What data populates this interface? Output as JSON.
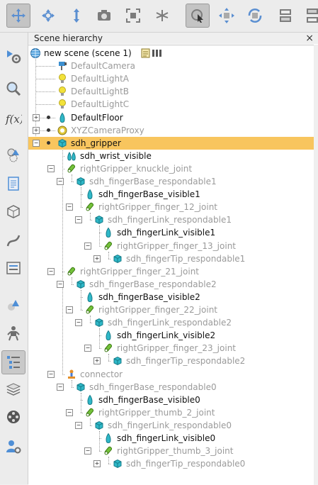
{
  "panel": {
    "title": "Scene hierarchy",
    "close": "×"
  },
  "toolbar": [
    {
      "icon": "move-view-icon",
      "active": true
    },
    {
      "icon": "rotate-view-icon",
      "active": false
    },
    {
      "icon": "shift-view-icon",
      "active": false
    },
    {
      "icon": "camera-icon",
      "active": false
    },
    {
      "icon": "fit-view-icon",
      "active": false
    },
    {
      "icon": "fly-icon",
      "active": false
    },
    {
      "icon": "select-icon",
      "active": true
    },
    {
      "icon": "object-move-icon",
      "active": false
    },
    {
      "icon": "object-rotate-icon",
      "active": false
    },
    {
      "icon": "assemble-icon",
      "active": false
    },
    {
      "icon": "disassemble-icon",
      "active": false
    }
  ],
  "sidebar": [
    {
      "icon": "simulation-settings-icon",
      "active": false
    },
    {
      "icon": "zoom-icon",
      "active": false
    },
    {
      "icon": "script-function-icon",
      "active": false
    },
    {
      "icon": "shape-edit-icon",
      "active": false
    },
    {
      "icon": "document-icon",
      "active": false
    },
    {
      "icon": "cube-icon",
      "active": false
    },
    {
      "icon": "path-icon",
      "active": false
    },
    {
      "icon": "panel-icon",
      "active": false
    },
    {
      "icon": "shapes-icon",
      "active": false
    },
    {
      "icon": "robot-icon",
      "active": false
    },
    {
      "icon": "hierarchy-list-icon",
      "active": true
    },
    {
      "icon": "layers-icon",
      "active": false
    },
    {
      "icon": "film-icon",
      "active": false
    },
    {
      "icon": "user-settings-icon",
      "active": false
    }
  ],
  "tree": [
    {
      "label": "new scene (scene 1)",
      "depth": 0,
      "icon": "globe",
      "style": "blk",
      "extra": true
    },
    {
      "label": "DefaultCamera",
      "depth": 1,
      "icon": "camera",
      "style": "gray"
    },
    {
      "label": "DefaultLightA",
      "depth": 1,
      "icon": "light",
      "style": "gray"
    },
    {
      "label": "DefaultLightB",
      "depth": 1,
      "icon": "light",
      "style": "gray"
    },
    {
      "label": "DefaultLightC",
      "depth": 1,
      "icon": "light",
      "style": "gray"
    },
    {
      "label": "DefaultFloor",
      "depth": 1,
      "icon": "shape-visible",
      "style": "blk",
      "expander": "+",
      "dot": true
    },
    {
      "label": "XYZCameraProxy",
      "depth": 1,
      "icon": "dummy",
      "style": "gray",
      "expander": "+",
      "dot": true
    },
    {
      "label": "sdh_gripper",
      "depth": 1,
      "icon": "shape-respondable",
      "style": "blk",
      "expander": "−",
      "dot": true,
      "selected": true
    },
    {
      "label": "sdh_wrist_visible",
      "depth": 2,
      "icon": "shape-visible-multi",
      "style": "blk"
    },
    {
      "label": "rightGripper_knuckle_joint",
      "depth": 2,
      "icon": "joint",
      "style": "gray",
      "expander": "−"
    },
    {
      "label": "sdh_fingerBase_respondable1",
      "depth": 3,
      "icon": "shape-respondable",
      "style": "gray",
      "expander": "−"
    },
    {
      "label": "sdh_fingerBase_visible1",
      "depth": 4,
      "icon": "shape-visible",
      "style": "blk"
    },
    {
      "label": "rightGripper_finger_12_joint",
      "depth": 4,
      "icon": "joint",
      "style": "gray",
      "expander": "−"
    },
    {
      "label": "sdh_fingerLink_respondable1",
      "depth": 5,
      "icon": "shape-respondable",
      "style": "gray",
      "expander": "−"
    },
    {
      "label": "sdh_fingerLink_visible1",
      "depth": 6,
      "icon": "shape-visible",
      "style": "blk"
    },
    {
      "label": "rightGripper_finger_13_joint",
      "depth": 6,
      "icon": "joint",
      "style": "gray",
      "expander": "−"
    },
    {
      "label": "sdh_fingerTip_respondable1",
      "depth": 7,
      "icon": "shape-respondable",
      "style": "gray",
      "expander": "+"
    },
    {
      "label": "rightGripper_finger_21_joint",
      "depth": 2,
      "icon": "joint",
      "style": "gray",
      "expander": "−"
    },
    {
      "label": "sdh_fingerBase_respondable2",
      "depth": 3,
      "icon": "shape-respondable",
      "style": "gray",
      "expander": "−"
    },
    {
      "label": "sdh_fingerBase_visible2",
      "depth": 4,
      "icon": "shape-visible",
      "style": "blk"
    },
    {
      "label": "rightGripper_finger_22_joint",
      "depth": 4,
      "icon": "joint",
      "style": "gray",
      "expander": "−"
    },
    {
      "label": "sdh_fingerLink_respondable2",
      "depth": 5,
      "icon": "shape-respondable",
      "style": "gray",
      "expander": "−"
    },
    {
      "label": "sdh_fingerLink_visible2",
      "depth": 6,
      "icon": "shape-visible",
      "style": "blk"
    },
    {
      "label": "rightGripper_finger_23_joint",
      "depth": 6,
      "icon": "joint",
      "style": "gray",
      "expander": "−"
    },
    {
      "label": "sdh_fingerTip_respondable2",
      "depth": 7,
      "icon": "shape-respondable",
      "style": "gray",
      "expander": "+"
    },
    {
      "label": "connector",
      "depth": 2,
      "icon": "connector",
      "style": "gray",
      "expander": "−"
    },
    {
      "label": "sdh_fingerBase_respondable0",
      "depth": 3,
      "icon": "shape-respondable",
      "style": "gray",
      "expander": "−"
    },
    {
      "label": "sdh_fingerBase_visible0",
      "depth": 4,
      "icon": "shape-visible",
      "style": "blk"
    },
    {
      "label": "rightGripper_thumb_2_joint",
      "depth": 4,
      "icon": "joint",
      "style": "gray",
      "expander": "−"
    },
    {
      "label": "sdh_fingerLink_respondable0",
      "depth": 5,
      "icon": "shape-respondable",
      "style": "gray",
      "expander": "−"
    },
    {
      "label": "sdh_fingerLink_visible0",
      "depth": 6,
      "icon": "shape-visible",
      "style": "blk"
    },
    {
      "label": "rightGripper_thumb_3_joint",
      "depth": 6,
      "icon": "joint",
      "style": "gray",
      "expander": "−"
    },
    {
      "label": "sdh_fingerTip_respondable0",
      "depth": 7,
      "icon": "shape-respondable",
      "style": "gray",
      "expander": "+"
    }
  ],
  "colors": {
    "selection": "#f8c55e",
    "cyan": "#2fb8c8",
    "joint": "#74c23a",
    "light": "#f2e23a"
  }
}
